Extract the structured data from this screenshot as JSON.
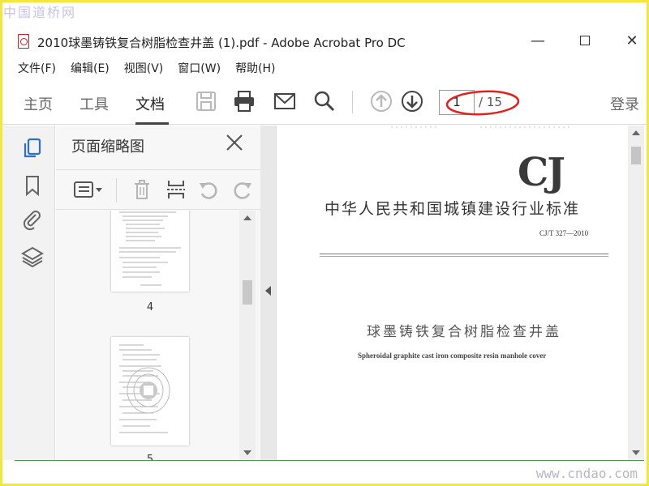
{
  "watermarks": {
    "top": "中国道桥网",
    "bottom": "www.cndao.com"
  },
  "window": {
    "title": "2010球墨铸铁复合树脂检查井盖 (1).pdf - Adobe Acrobat Pro DC",
    "minimize": "—",
    "close": "✕"
  },
  "menu": {
    "file": "文件(F)",
    "edit": "编辑(E)",
    "view": "视图(V)",
    "window": "窗口(W)",
    "help": "帮助(H)"
  },
  "toolbar": {
    "tab_home": "主页",
    "tab_tools": "工具",
    "tab_document": "文档",
    "page_current": "1",
    "page_total": "/ 15",
    "login": "登录",
    "icons": [
      "save-icon",
      "print-icon",
      "email-icon",
      "search-icon",
      "arrow-up-icon",
      "arrow-down-icon"
    ]
  },
  "sidebar_rail": {
    "icons": [
      "page-thumbnails-icon",
      "bookmark-icon",
      "attachment-icon",
      "layers-icon"
    ]
  },
  "thumbnails_panel": {
    "title": "页面缩略图",
    "tools": [
      "options-menu-icon",
      "delete-icon",
      "extract-icon",
      "rotate-left-icon",
      "rotate-right-icon"
    ],
    "pages": [
      {
        "number": "4"
      },
      {
        "number": "5"
      }
    ]
  },
  "document": {
    "logo": "CJ",
    "standard_title": "中华人民共和国城镇建设行业标准",
    "standard_code": "CJ/T 327—2010",
    "cn_title": "球墨铸铁复合树脂检查井盖",
    "en_title": "Spheroidal graphite cast iron composite resin manhole cover"
  },
  "colors": {
    "accent_red": "#d71920",
    "frame": "#f2e73a",
    "annotation_ellipse": "#e0221b"
  }
}
